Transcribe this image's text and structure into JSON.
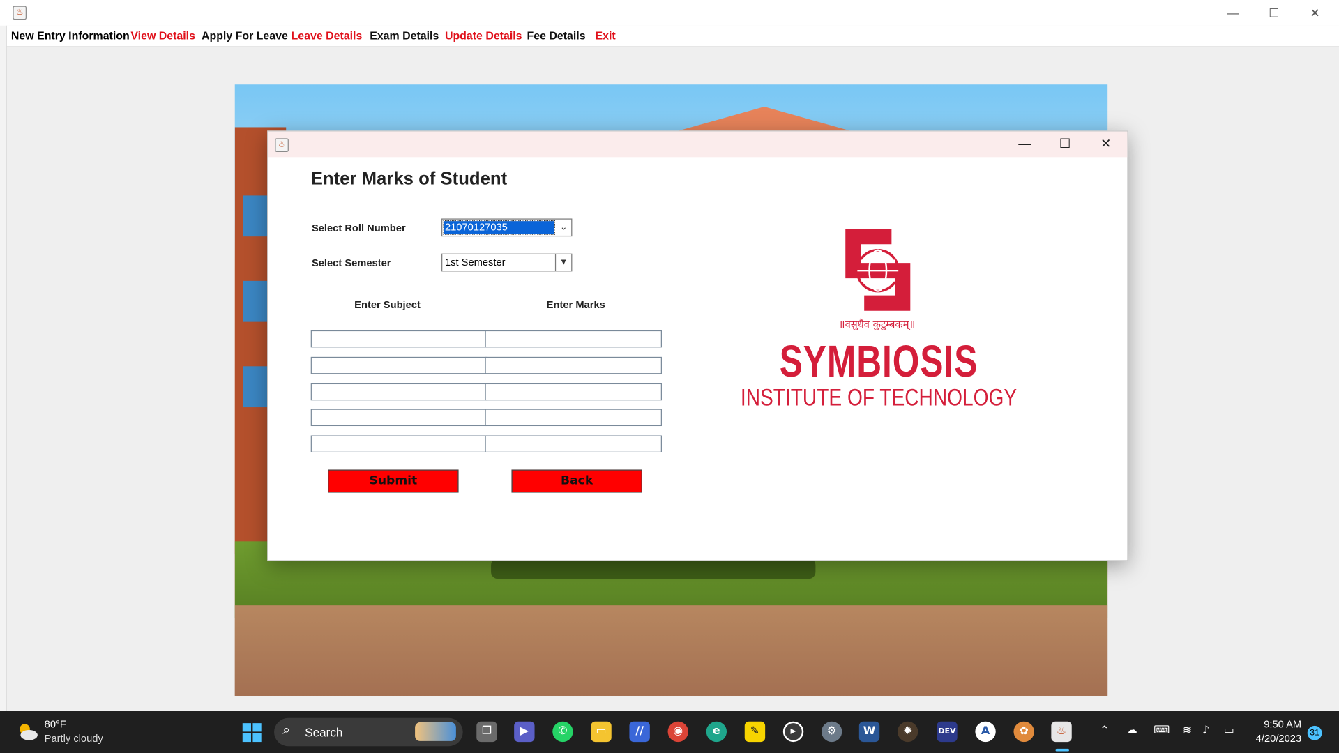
{
  "menu": {
    "items": [
      {
        "label": "New Entry Information",
        "color": "#111111"
      },
      {
        "label": "View Details",
        "color": "#e0101a"
      },
      {
        "label": "Apply For Leave",
        "color": "#111111"
      },
      {
        "label": "Leave Details",
        "color": "#e0101a"
      },
      {
        "label": "Exam Details",
        "color": "#111111"
      },
      {
        "label": "Update Details",
        "color": "#e0101a"
      },
      {
        "label": "Fee Details",
        "color": "#111111"
      },
      {
        "label": "Exit",
        "color": "#e0101a"
      }
    ]
  },
  "dialog": {
    "heading": "Enter Marks of Student",
    "roll_label": "Select Roll Number",
    "roll_value": "21070127035",
    "semester_label": "Select Semester",
    "semester_value": "1st Semester",
    "subject_header": "Enter Subject",
    "marks_header": "Enter Marks",
    "rows": [
      {
        "subject": "",
        "marks": ""
      },
      {
        "subject": "",
        "marks": ""
      },
      {
        "subject": "",
        "marks": ""
      },
      {
        "subject": "",
        "marks": ""
      },
      {
        "subject": "",
        "marks": ""
      }
    ],
    "submit_label": "Submit",
    "back_label": "Back",
    "button_color": "#ff0000"
  },
  "logo": {
    "motto": "॥वसुधैव कुटुम्बकम्॥",
    "name": "SYMBIOSIS",
    "subtitle": "INSTITUTE OF TECHNOLOGY",
    "color": "#d41e3a"
  },
  "taskbar": {
    "weather_temp": "80°F",
    "weather_desc": "Partly cloudy",
    "search_placeholder": "Search",
    "time": "9:50 AM",
    "date": "4/20/2023",
    "notification_count": "31",
    "apps": [
      "start-icon",
      "task-view-icon",
      "teams-icon",
      "whatsapp-icon",
      "file-explorer-icon",
      "visual-studio-icon",
      "chrome-icon",
      "edge-icon",
      "sticky-notes-icon",
      "media-player-icon",
      "settings-icon",
      "word-icon",
      "app-icon",
      "devcpp-icon",
      "app-icon-2",
      "paint-icon",
      "java-icon"
    ]
  }
}
